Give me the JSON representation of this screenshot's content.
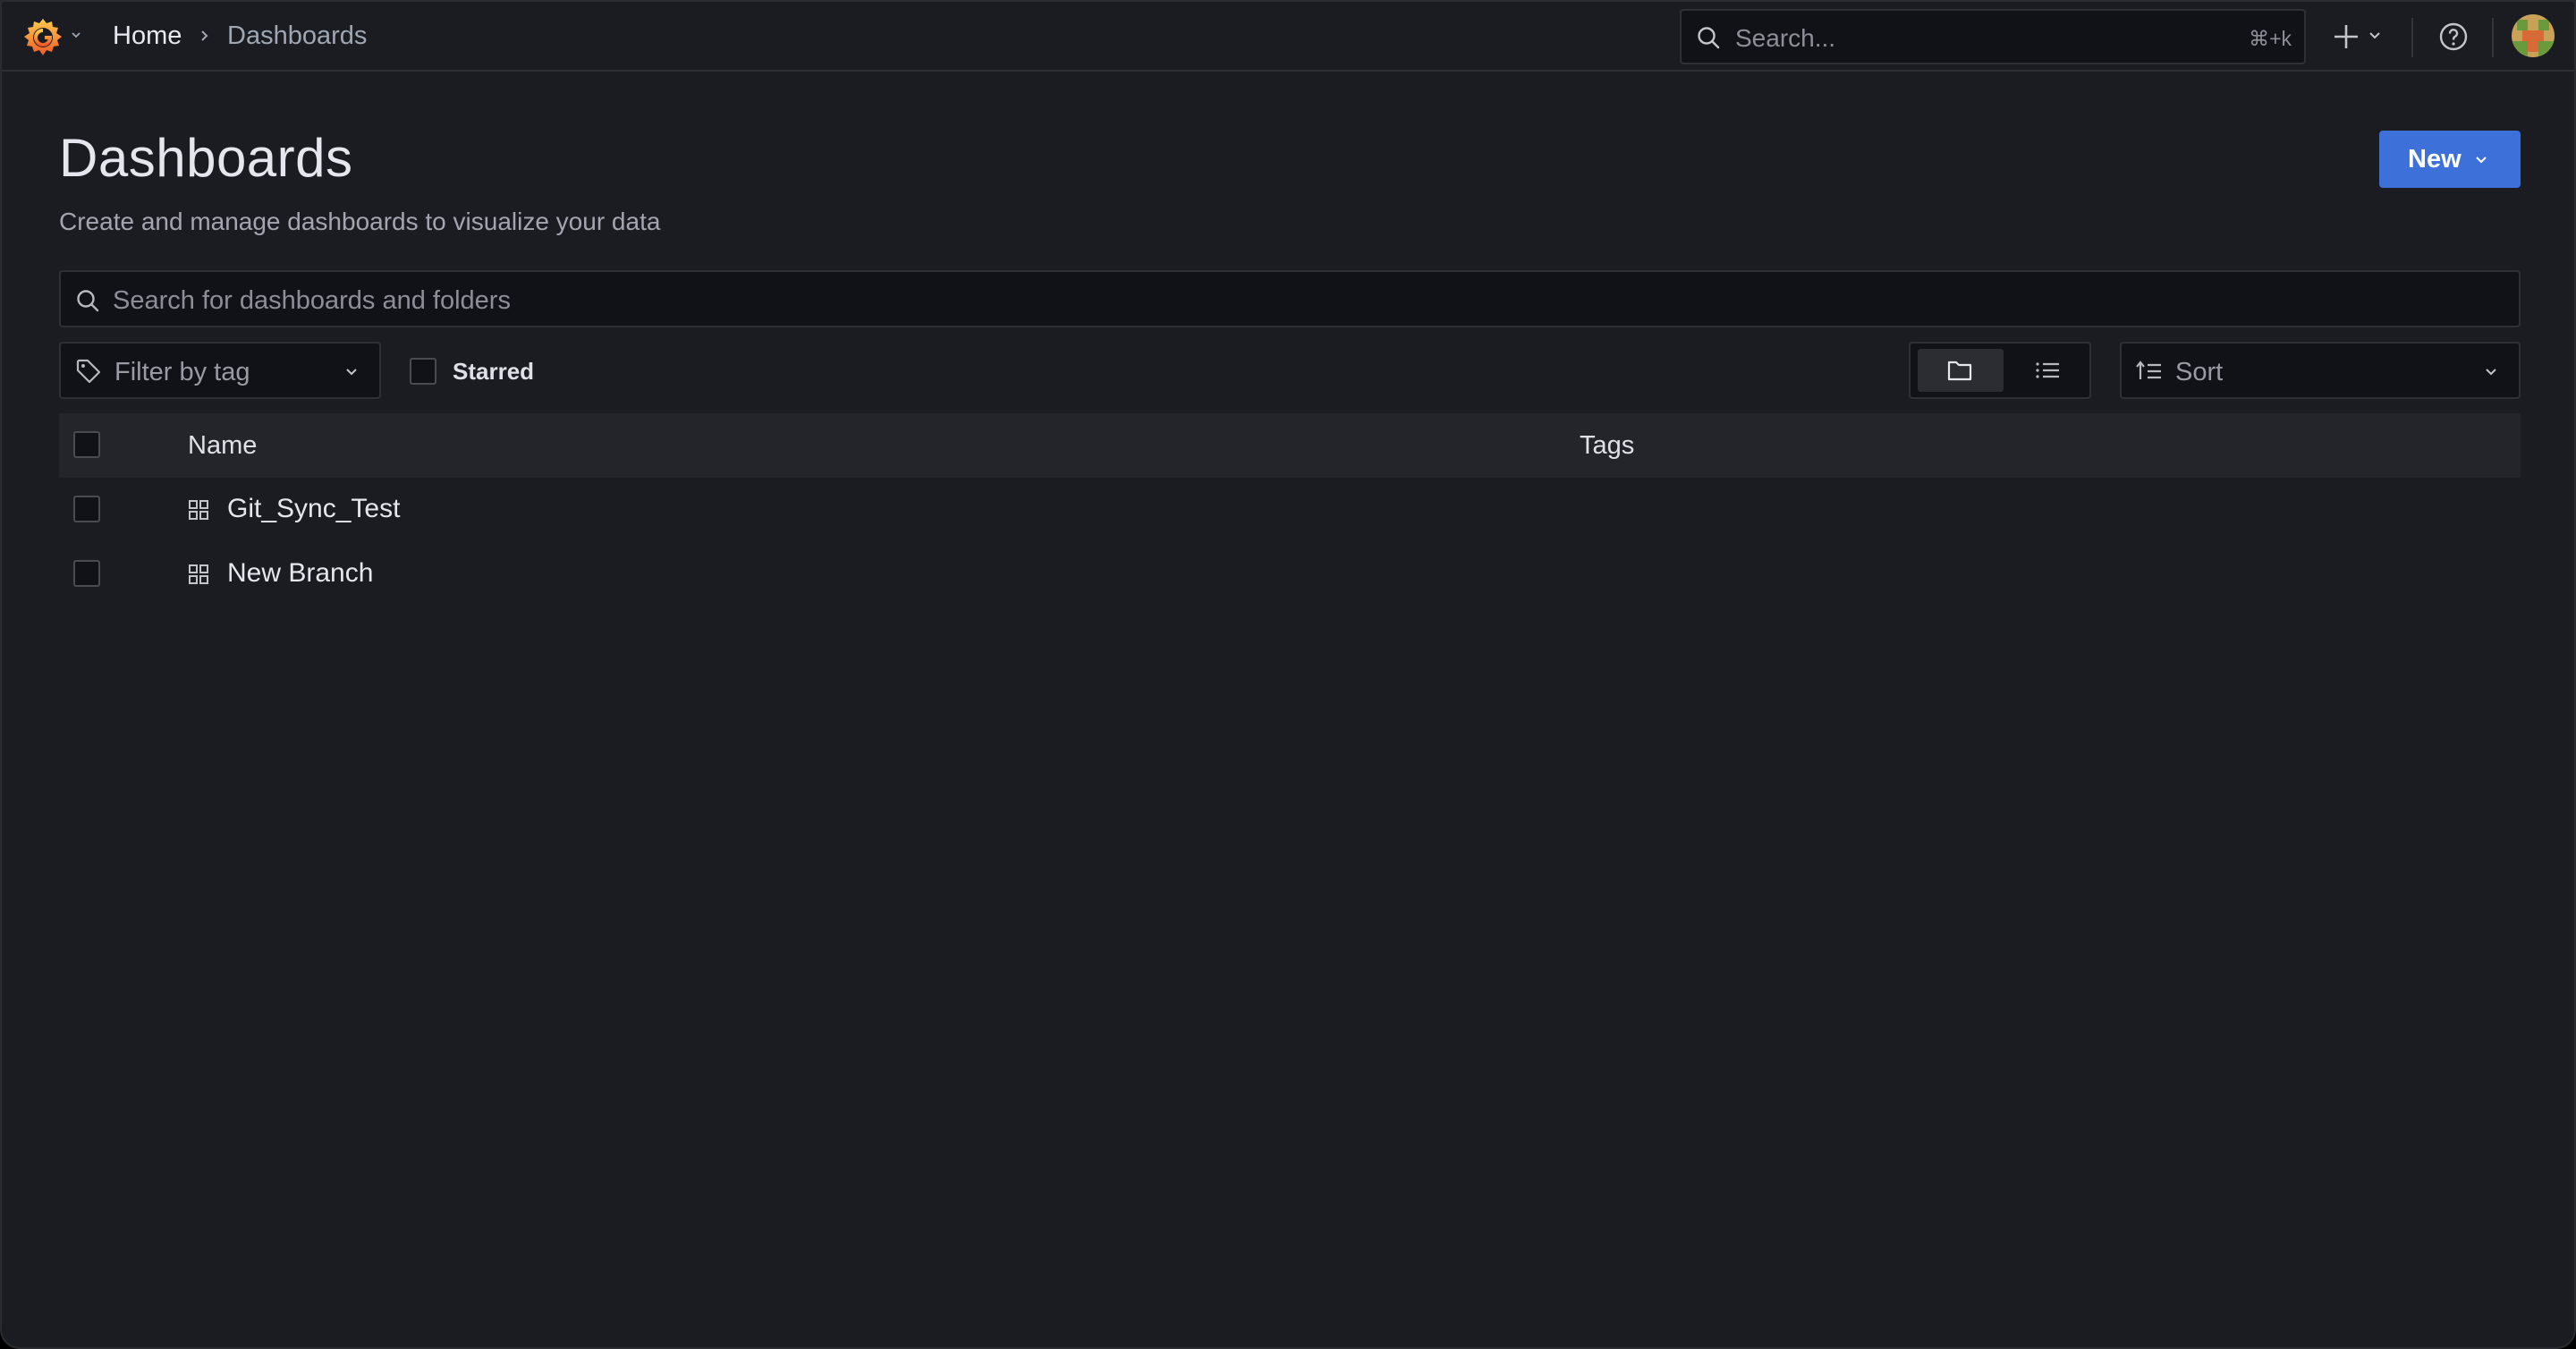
{
  "topbar": {
    "breadcrumb": {
      "home": "Home",
      "current": "Dashboards"
    },
    "search": {
      "placeholder": "Search...",
      "shortcut": "⌘+k"
    }
  },
  "page": {
    "title": "Dashboards",
    "subtitle": "Create and manage dashboards to visualize your data",
    "new_button": "New"
  },
  "filters": {
    "search_placeholder": "Search for dashboards and folders",
    "tag_placeholder": "Filter by tag",
    "starred_label": "Starred",
    "starred_checked": false,
    "view_mode": "folder",
    "sort_placeholder": "Sort"
  },
  "table": {
    "columns": {
      "name": "Name",
      "tags": "Tags"
    },
    "rows": [
      {
        "name": "Git_Sync_Test",
        "tags": []
      },
      {
        "name": "New Branch",
        "tags": []
      }
    ]
  },
  "colors": {
    "background": "#1b1c21",
    "primary": "#3d71d9",
    "logo": "#f46800"
  },
  "icons": [
    "grafana-logo-icon",
    "search-icon",
    "plus-icon",
    "help-icon",
    "tag-icon",
    "folder-view-icon",
    "list-view-icon",
    "sort-icon",
    "dashboard-icon"
  ]
}
